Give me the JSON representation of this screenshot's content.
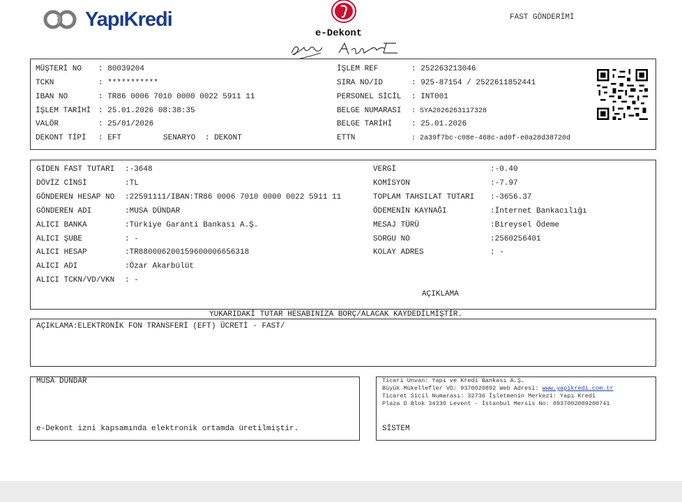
{
  "header": {
    "brand": "YapıKredi",
    "doc_title": "e-Dekont",
    "doc_type": "FAST GÖNDERİMİ"
  },
  "customer": {
    "musteri_no": {
      "label": "MÜŞTERİ NO",
      "value": ": 80039204"
    },
    "tckn": {
      "label": "TCKN",
      "value": ": ***********"
    },
    "iban": {
      "label": "IBAN NO",
      "value": ": TR86 0006 7010 0000 0022 5911 11"
    },
    "islem_tarihi": {
      "label": "İŞLEM TARİHİ",
      "value": ": 25.01.2026 08:38:35"
    },
    "valor": {
      "label": "VALÖR",
      "value": ": 25/01/2026"
    },
    "dekont_tipi": {
      "label": "DEKONT TİPİ",
      "value": ": EFT"
    },
    "senaryo": {
      "label": "SENARYO",
      "value": ": DEKONT"
    },
    "islem_ref": {
      "label": "İŞLEM REF",
      "value": ": 252263213046"
    },
    "sira_no": {
      "label": "SIRA NO/ID",
      "value": ": 925-87154 / 2522611852441"
    },
    "personel": {
      "label": "PERSONEL SİCİL",
      "value": ": INT001"
    },
    "belge_no": {
      "label": "BELGE NUMARASI",
      "value": ": SYA2026263117328"
    },
    "belge_tarihi": {
      "label": "BELGE TARİHİ",
      "value": ": 25.01.2026"
    },
    "ettn": {
      "label": "ETTN",
      "value": ": 2a39f7bc-c08e-468c-ad0f-e0a28d38720d"
    }
  },
  "transfer": {
    "left": [
      {
        "label": "GİDEN FAST TUTARI",
        "value": ":-3648"
      },
      {
        "label": "DÖVİZ CİNSİ",
        "value": ":TL"
      },
      {
        "label": "GÖNDEREN HESAP NO",
        "value": ":22591111/IBAN:TR86 0006 7010 0000 0022 5911 11"
      },
      {
        "label": "GÖNDEREN ADI",
        "value": ":MUSA DÜNDAR"
      },
      {
        "label": "ALICI BANKA",
        "value": ":Türkiye Garanti Bankası A.Ş."
      },
      {
        "label": "ALICI ŞUBE",
        "value": ": -"
      },
      {
        "label": "ALICI HESAP",
        "value": ":TR880006200159600006656318"
      },
      {
        "label": "ALICI ADI",
        "value": ":Özar Akarbülüt"
      },
      {
        "label": "ALICI TCKN/VD/VKN",
        "value": ": -"
      }
    ],
    "right": [
      {
        "label": "VERGİ",
        "value": ":-0.40"
      },
      {
        "label": "KOMİSYON",
        "value": ":-7.97"
      },
      {
        "label": "TOPLAM TAHSILAT TUTARI",
        "value": ":-3656.37"
      },
      {
        "label": "ÖDEMENİN KAYNAĞI",
        "value": ":İnternet Bankacılığı"
      },
      {
        "label": "MESAJ TÜRÜ",
        "value": ":Bireysel Ödeme"
      },
      {
        "label": "SORGU NO",
        "value": ":2560256401"
      },
      {
        "label": "KOLAY ADRES",
        "value": ": -"
      }
    ],
    "aciklama_title": "AÇIKLAMA"
  },
  "notice": "YUKARIDAKİ TUTAR HESABINIZA BORÇ/ALACAK KAYDEDİLMİŞTİR.",
  "description": "AÇIKLAMA:ELEKTRONİK FON TRANSFERİ (EFT) ÜCRETİ - FAST/",
  "bottom_left": {
    "name": "MUSA DÜNDAR",
    "note": "e-Dekont izni kapsamında elektronik ortamda üretilmiştir."
  },
  "bottom_right": {
    "line1": "Ticari Unvan: Yapı ve Kredi Bankası A.Ş.",
    "line2_prefix": "Büyük Mükellefler VD: 9370020892 Web Adresi: ",
    "web": "www.yapikredi.com.tr",
    "line3": "Ticaret Sicil Numarası: 32736 İşletmenin Merkezi: Yapı Kredi",
    "line4": "Plaza D Blok 34330 Levent - İstanbul Mersis No: 0937002089200741",
    "system": "SİSTEM"
  },
  "colors": {
    "brand_blue": "#1b3c8c",
    "emblem_red": "#c8102e",
    "border": "#333333"
  }
}
